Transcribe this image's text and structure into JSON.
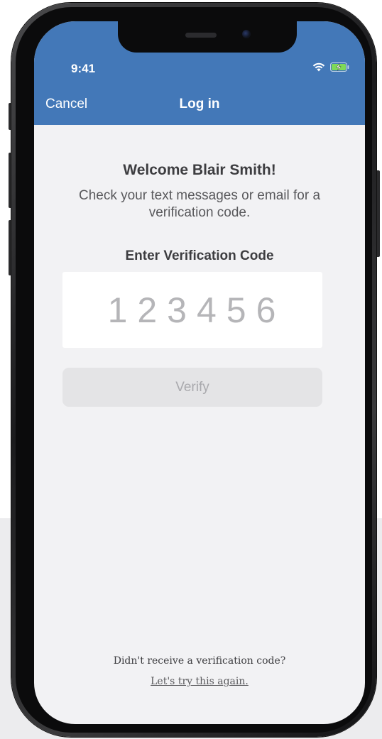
{
  "status_bar": {
    "time": "9:41",
    "icons": [
      "wifi-icon",
      "battery-charging-icon"
    ],
    "battery_color": "#7ed957"
  },
  "nav": {
    "cancel_label": "Cancel",
    "title": "Log in"
  },
  "content": {
    "welcome": "Welcome Blair Smith!",
    "instructions": "Check your text messages or email for a verification code.",
    "code_label": "Enter Verification Code",
    "code_placeholder": "123456",
    "code_value": "",
    "verify_label": "Verify"
  },
  "footer": {
    "question": "Didn't receive a verification code?",
    "link": "Let's try this again."
  },
  "colors": {
    "header": "#4378b8",
    "screen_bg": "#f2f2f4",
    "button_bg": "#e4e4e6"
  }
}
